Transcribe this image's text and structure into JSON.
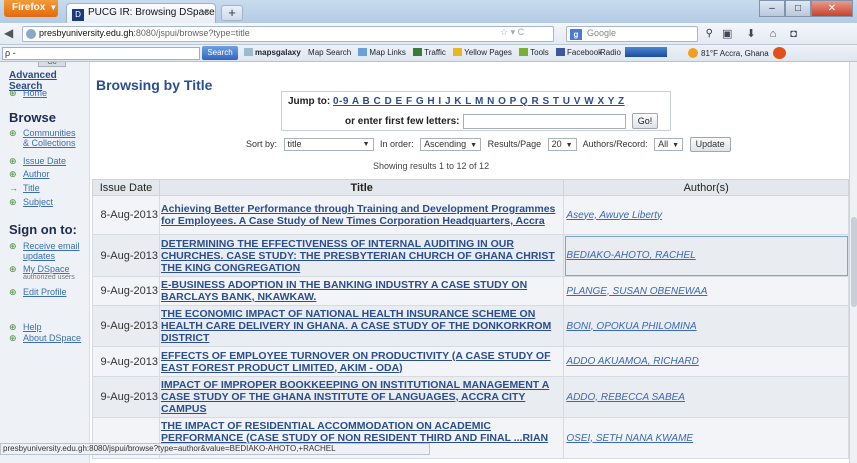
{
  "browser": {
    "menu_label": "Firefox",
    "tab_title": "PUCG IR: Browsing DSpace",
    "new_tab": "+",
    "url_host": "presbyuniversity.edu.gh",
    "url_rest": ":8080/jspui/browse?type=title",
    "url_tools": "☆ ▾ C",
    "search_placeholder": "Google",
    "window": {
      "minimize": "–",
      "maximize": "□",
      "close": "✕"
    }
  },
  "toolbar": {
    "search_value": "ρ -",
    "search_button": "Search",
    "links": [
      "mapsgalaxy",
      "Map Search",
      "Map Links",
      "Traffic",
      "Yellow Pages",
      "Tools",
      "Facebook"
    ],
    "radio_label": "Radio",
    "weather": "81°F Accra, Ghana"
  },
  "sidebar": {
    "go": "Go",
    "advanced_search": "Advanced Search",
    "home": "Home",
    "browse_heading": "Browse",
    "communities_1": "Communities",
    "communities_2": "& Collections",
    "issue_date": "Issue Date",
    "author": "Author",
    "title": "Title",
    "subject": "Subject",
    "sign_on_heading": "Sign on to:",
    "receive_email_1": "Receive email",
    "receive_email_2": "updates",
    "my_dspace": "My DSpace",
    "my_dspace_note": "authorized users",
    "edit_profile": "Edit Profile",
    "help": "Help",
    "about": "About DSpace"
  },
  "main": {
    "page_title": "Browsing by Title",
    "jump_to": "Jump to:",
    "jump_letters": "0-9 A B C D E F G H I J K L M N O P Q R S T U V W X Y Z",
    "first_letters_label": "or enter first few letters:",
    "go_button": "Go!",
    "sort_by_label": "Sort by:",
    "sort_by_value": "title",
    "order_label": "In order:",
    "order_value": "Ascending",
    "results_label": "Results/Page",
    "results_value": "20",
    "authors_label": "Authors/Record:",
    "authors_value": "All",
    "update_button": "Update",
    "showing": "Showing results 1 to 12 of 12"
  },
  "table": {
    "headers": [
      "Issue Date",
      "Title",
      "Author(s)"
    ],
    "rows": [
      {
        "date": "8-Aug-2013",
        "title": "Achieving Better Performance through Training and Development Programmes for Employees. A Case Study of New Times Corporation Headquarters, Accra",
        "author": "Aseye, Awuye Liberty"
      },
      {
        "date": "9-Aug-2013",
        "title": "DETERMINING THE EFFECTIVENESS OF INTERNAL AUDITING IN OUR CHURCHES. CASE STUDY: THE PRESBYTERIAN CHURCH OF GHANA CHRIST THE KING CONGREGATION",
        "author": "BEDIAKO-AHOTO, RACHEL"
      },
      {
        "date": "9-Aug-2013",
        "title": "E-BUSINESS ADOPTION IN THE BANKING INDUSTRY A CASE STUDY ON BARCLAYS BANK, NKAWKAW.",
        "author": "PLANGE, SUSAN OBENEWAA"
      },
      {
        "date": "9-Aug-2013",
        "title": "THE ECONOMIC IMPACT OF NATIONAL HEALTH INSURANCE SCHEME ON HEALTH CARE DELIVERY IN GHANA. A CASE STUDY OF THE DONKORKROM DISTRICT",
        "author": "BONI, OPOKUA PHILOMINA"
      },
      {
        "date": "9-Aug-2013",
        "title": "EFFECTS OF EMPLOYEE TURNOVER ON PRODUCTIVITY (A CASE STUDY OF EAST FOREST PRODUCT LIMITED, AKIM - ODA)",
        "author": "ADDO AKUAMOA, RICHARD"
      },
      {
        "date": "9-Aug-2013",
        "title": "IMPACT OF IMPROPER BOOKKEEPING ON INSTITUTIONAL MANAGEMENT A CASE STUDY OF THE GHANA INSTITUTE OF LANGUAGES, ACCRA CITY CAMPUS",
        "author": "ADDO, REBECCA SABEA"
      },
      {
        "date": "",
        "title": "THE IMPACT OF RESIDENTIAL ACCOMMODATION ON ACADEMIC PERFORMANCE (CASE STUDY OF NON RESIDENT THIRD AND FINAL ...RIAN UNIVERSITY COLLEGE, OKWAHU",
        "author": "OSEI, SETH NANA KWAME"
      }
    ]
  },
  "statusbar": "presbyuniversity.edu.gh:8080/jspui/browse?type=author&value=BEDIAKO-AHOTO,+RACHEL"
}
